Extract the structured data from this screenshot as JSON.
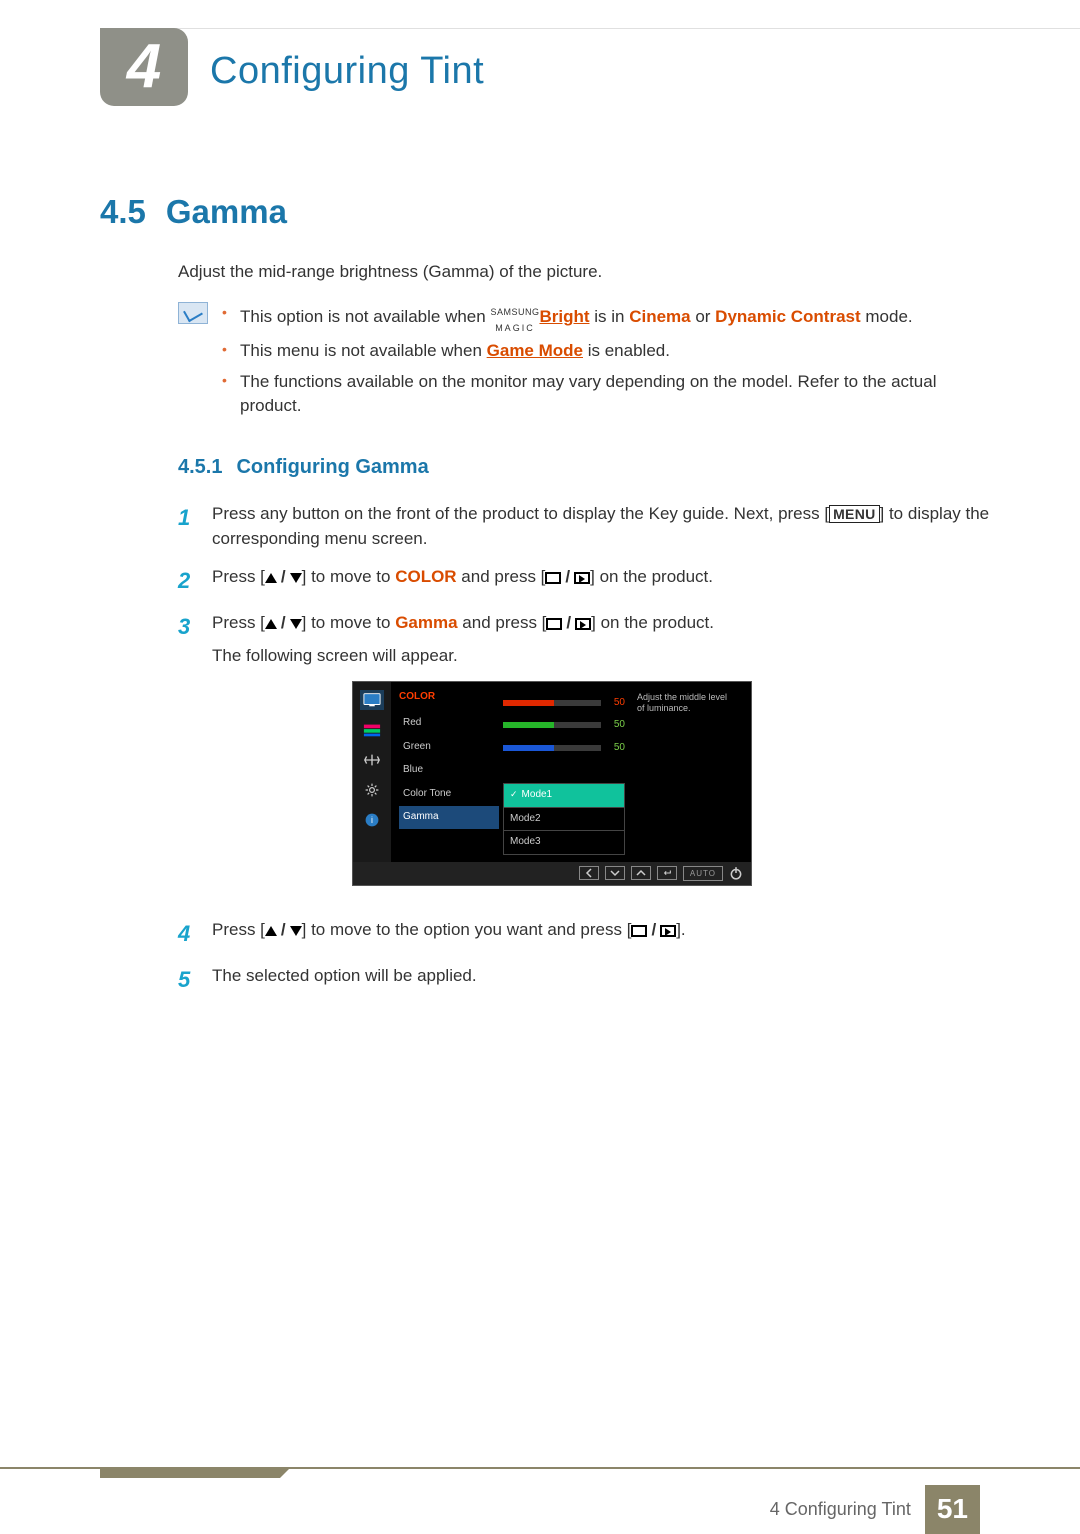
{
  "chapter": {
    "number": "4",
    "title": "Configuring Tint"
  },
  "section": {
    "number": "4.5",
    "title": "Gamma",
    "intro": "Adjust the mid-range brightness (Gamma) of the picture."
  },
  "notes": {
    "n1_a": "This option is not available when ",
    "magic_top": "SAMSUNG",
    "magic_bot": "MAGIC",
    "n1_b": "Bright",
    "n1_c": " is in ",
    "n1_d": "Cinema",
    "n1_e": " or ",
    "n1_f": "Dynamic Contrast",
    "n1_g": " mode.",
    "n2_a": "This menu is not available when ",
    "n2_b": "Game Mode",
    "n2_c": " is enabled.",
    "n3": "The functions available on the monitor may vary depending on the model. Refer to the actual product."
  },
  "subsection": {
    "number": "4.5.1",
    "title": "Configuring Gamma"
  },
  "steps": {
    "s1_a": "Press any button on the front of the product to display the Key guide. Next, press [",
    "s1_menu": "MENU",
    "s1_b": "] to display the corresponding menu screen.",
    "s2_a": "Press [",
    "s2_b": "] to move to ",
    "s2_c": "COLOR",
    "s2_d": " and press [",
    "s2_e": "] on the product.",
    "s3_a": "Press [",
    "s3_b": "] to move to ",
    "s3_c": "Gamma",
    "s3_d": " and press [",
    "s3_e": "] on the product.",
    "s3_appear": "The following screen will appear.",
    "s4_a": "Press [",
    "s4_b": "] to move to the option you want and press [",
    "s4_c": "].",
    "s5": "The selected option will be applied."
  },
  "osd": {
    "category": "COLOR",
    "items": {
      "red": "Red",
      "green": "Green",
      "blue": "Blue",
      "colortone": "Color Tone",
      "gamma": "Gamma"
    },
    "values": {
      "red": "50",
      "green": "50",
      "blue": "50"
    },
    "bars": {
      "red_pct": 52,
      "green_pct": 52,
      "blue_pct": 52
    },
    "modes": {
      "m1": "Mode1",
      "m2": "Mode2",
      "m3": "Mode3"
    },
    "help": "Adjust the middle level of luminance.",
    "auto": "AUTO"
  },
  "footer": {
    "label": "4 Configuring Tint",
    "page": "51"
  }
}
